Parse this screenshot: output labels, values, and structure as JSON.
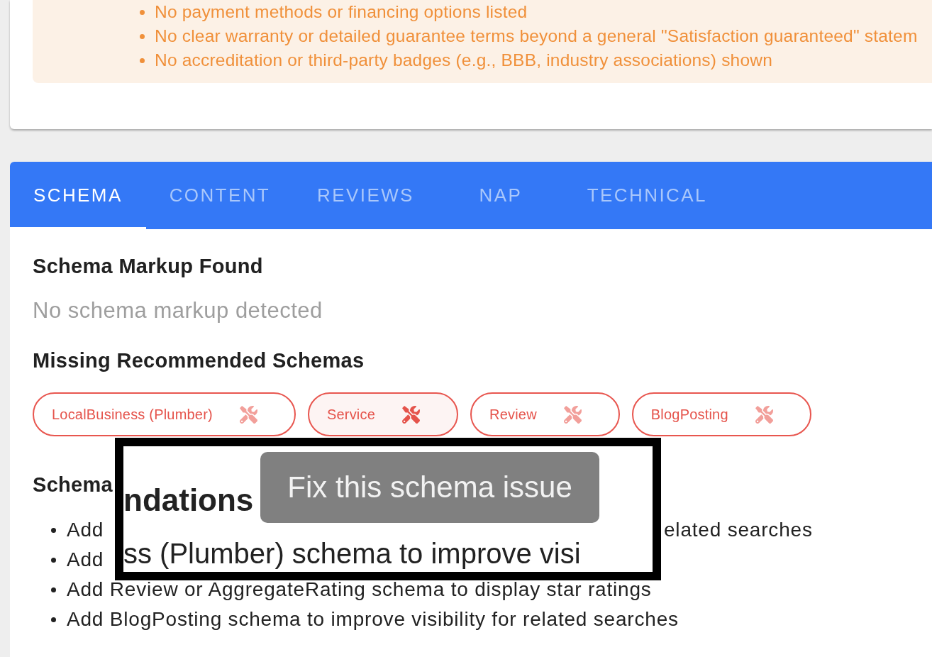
{
  "warning_list": {
    "items": [
      "No payment methods or financing options listed",
      "No clear warranty or detailed guarantee terms beyond a general \"Satisfaction guaranteed\" statem",
      "No accreditation or third-party badges (e.g., BBB, industry associations) shown"
    ]
  },
  "tabs": [
    {
      "label": "SCHEMA",
      "selected": true
    },
    {
      "label": "CONTENT",
      "selected": false
    },
    {
      "label": "REVIEWS",
      "selected": false
    },
    {
      "label": "NAP",
      "selected": false
    },
    {
      "label": "TECHNICAL",
      "selected": false
    }
  ],
  "schema_panel": {
    "found_heading": "Schema Markup Found",
    "found_text": "No schema markup detected",
    "missing_heading": "Missing Recommended Schemas",
    "missing_schemas": [
      {
        "label": "LocalBusiness (Plumber)",
        "hovered": false
      },
      {
        "label": "Service",
        "hovered": true
      },
      {
        "label": "Review",
        "hovered": false
      },
      {
        "label": "BlogPosting",
        "hovered": false
      }
    ],
    "recommendations_heading": "Schema",
    "recommendations": [
      {
        "parts": [
          "Add",
          "elated searches"
        ]
      },
      {
        "parts": [
          "Add"
        ]
      },
      {
        "parts": [
          "Add Review or AggregateRating schema to display star ratings"
        ]
      },
      {
        "parts": [
          "Add BlogPosting schema to improve visibility for related searches"
        ]
      }
    ]
  },
  "magnifier": {
    "magnified_heading": "ndations",
    "tooltip": "Fix this schema issue",
    "magnified_line": "ss (Plumber) schema to improve visi"
  }
}
